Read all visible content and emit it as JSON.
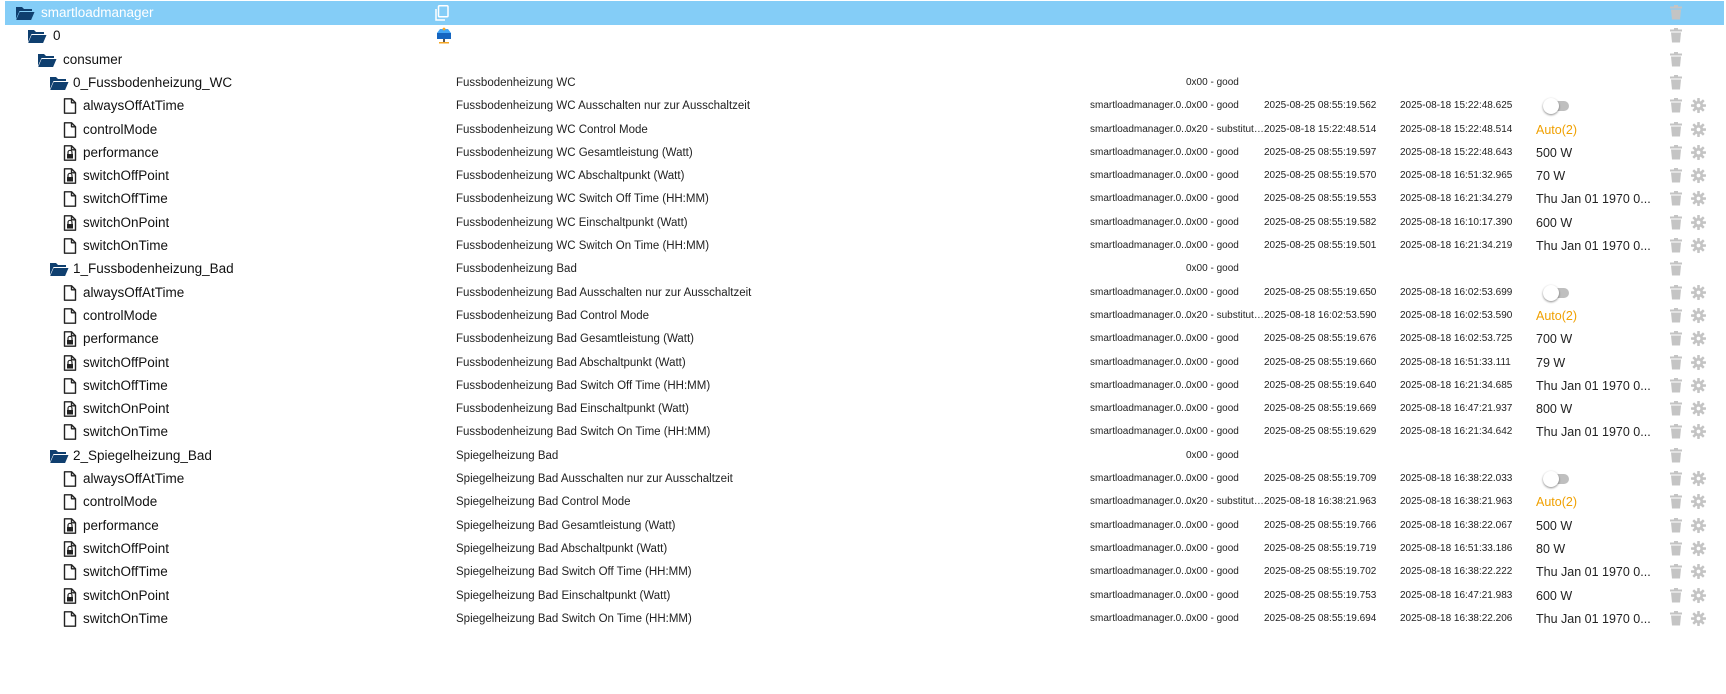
{
  "colors": {
    "selection": "#84cdf7",
    "auto_value": "#f0a000",
    "folder": "#0f3f6f",
    "action_icons": "#c4c4c4"
  },
  "root_row": {
    "name": "smartloadmanager",
    "copy_icon": "copy-icon"
  },
  "instance_row": {
    "name": "0",
    "adapter_icon": "smartloadmanager-logo-icon"
  },
  "consumer_row": {
    "name": "consumer"
  },
  "groups": [
    {
      "name": "0_Fussbodenheizung_WC",
      "desc": "Fussbodenheizung WC",
      "quality": "0x00 - good",
      "states": [
        {
          "name": "alwaysOffAtTime",
          "icon": "file",
          "desc": "Fussbodenheizung WC Ausschalten nur zur Ausschaltzeit",
          "from": "smartloadmanager.0...",
          "quality": "0x00 - good",
          "ts": "2025-08-25 08:55:19.562",
          "lc": "2025-08-18 15:22:48.625",
          "value": "",
          "type": "toggle"
        },
        {
          "name": "controlMode",
          "icon": "file",
          "desc": "Fussbodenheizung WC Control Mode",
          "from": "smartloadmanager.0...",
          "quality": "0x20 - substitute...",
          "ts": "2025-08-18 15:22:48.514",
          "lc": "2025-08-18 15:22:48.514",
          "value": "Auto(2)",
          "type": "auto"
        },
        {
          "name": "performance",
          "icon": "lock",
          "desc": "Fussbodenheizung WC Gesamtleistung (Watt)",
          "from": "smartloadmanager.0...",
          "quality": "0x00 - good",
          "ts": "2025-08-25 08:55:19.597",
          "lc": "2025-08-18 15:22:48.643",
          "value": "500 W",
          "type": "text"
        },
        {
          "name": "switchOffPoint",
          "icon": "lock",
          "desc": "Fussbodenheizung WC Abschaltpunkt (Watt)",
          "from": "smartloadmanager.0...",
          "quality": "0x00 - good",
          "ts": "2025-08-25 08:55:19.570",
          "lc": "2025-08-18 16:51:32.965",
          "value": "70 W",
          "type": "text"
        },
        {
          "name": "switchOffTime",
          "icon": "file",
          "desc": "Fussbodenheizung WC Switch Off Time (HH:MM)",
          "from": "smartloadmanager.0...",
          "quality": "0x00 - good",
          "ts": "2025-08-25 08:55:19.553",
          "lc": "2025-08-18 16:21:34.279",
          "value": "Thu Jan 01 1970 0...",
          "type": "text"
        },
        {
          "name": "switchOnPoint",
          "icon": "lock",
          "desc": "Fussbodenheizung WC Einschaltpunkt (Watt)",
          "from": "smartloadmanager.0...",
          "quality": "0x00 - good",
          "ts": "2025-08-25 08:55:19.582",
          "lc": "2025-08-18 16:10:17.390",
          "value": "600 W",
          "type": "text"
        },
        {
          "name": "switchOnTime",
          "icon": "file",
          "desc": "Fussbodenheizung WC Switch On Time (HH:MM)",
          "from": "smartloadmanager.0...",
          "quality": "0x00 - good",
          "ts": "2025-08-25 08:55:19.501",
          "lc": "2025-08-18 16:21:34.219",
          "value": "Thu Jan 01 1970 0...",
          "type": "text"
        }
      ]
    },
    {
      "name": "1_Fussbodenheizung_Bad",
      "desc": "Fussbodenheizung Bad",
      "quality": "0x00 - good",
      "states": [
        {
          "name": "alwaysOffAtTime",
          "icon": "file",
          "desc": "Fussbodenheizung Bad Ausschalten nur zur Ausschaltzeit",
          "from": "smartloadmanager.0...",
          "quality": "0x00 - good",
          "ts": "2025-08-25 08:55:19.650",
          "lc": "2025-08-18 16:02:53.699",
          "value": "",
          "type": "toggle"
        },
        {
          "name": "controlMode",
          "icon": "file",
          "desc": "Fussbodenheizung Bad Control Mode",
          "from": "smartloadmanager.0...",
          "quality": "0x20 - substitute...",
          "ts": "2025-08-18 16:02:53.590",
          "lc": "2025-08-18 16:02:53.590",
          "value": "Auto(2)",
          "type": "auto"
        },
        {
          "name": "performance",
          "icon": "lock",
          "desc": "Fussbodenheizung Bad Gesamtleistung (Watt)",
          "from": "smartloadmanager.0...",
          "quality": "0x00 - good",
          "ts": "2025-08-25 08:55:19.676",
          "lc": "2025-08-18 16:02:53.725",
          "value": "700 W",
          "type": "text"
        },
        {
          "name": "switchOffPoint",
          "icon": "lock",
          "desc": "Fussbodenheizung Bad Abschaltpunkt (Watt)",
          "from": "smartloadmanager.0...",
          "quality": "0x00 - good",
          "ts": "2025-08-25 08:55:19.660",
          "lc": "2025-08-18 16:51:33.111",
          "value": "79 W",
          "type": "text"
        },
        {
          "name": "switchOffTime",
          "icon": "file",
          "desc": "Fussbodenheizung Bad Switch Off Time (HH:MM)",
          "from": "smartloadmanager.0...",
          "quality": "0x00 - good",
          "ts": "2025-08-25 08:55:19.640",
          "lc": "2025-08-18 16:21:34.685",
          "value": "Thu Jan 01 1970 0...",
          "type": "text"
        },
        {
          "name": "switchOnPoint",
          "icon": "lock",
          "desc": "Fussbodenheizung Bad Einschaltpunkt (Watt)",
          "from": "smartloadmanager.0...",
          "quality": "0x00 - good",
          "ts": "2025-08-25 08:55:19.669",
          "lc": "2025-08-18 16:47:21.937",
          "value": "800 W",
          "type": "text"
        },
        {
          "name": "switchOnTime",
          "icon": "file",
          "desc": "Fussbodenheizung Bad Switch On Time (HH:MM)",
          "from": "smartloadmanager.0...",
          "quality": "0x00 - good",
          "ts": "2025-08-25 08:55:19.629",
          "lc": "2025-08-18 16:21:34.642",
          "value": "Thu Jan 01 1970 0...",
          "type": "text"
        }
      ]
    },
    {
      "name": "2_Spiegelheizung_Bad",
      "desc": "Spiegelheizung Bad",
      "quality": "0x00 - good",
      "states": [
        {
          "name": "alwaysOffAtTime",
          "icon": "file",
          "desc": "Spiegelheizung Bad Ausschalten nur zur Ausschaltzeit",
          "from": "smartloadmanager.0...",
          "quality": "0x00 - good",
          "ts": "2025-08-25 08:55:19.709",
          "lc": "2025-08-18 16:38:22.033",
          "value": "",
          "type": "toggle"
        },
        {
          "name": "controlMode",
          "icon": "file",
          "desc": "Spiegelheizung Bad Control Mode",
          "from": "smartloadmanager.0...",
          "quality": "0x20 - substitute...",
          "ts": "2025-08-18 16:38:21.963",
          "lc": "2025-08-18 16:38:21.963",
          "value": "Auto(2)",
          "type": "auto"
        },
        {
          "name": "performance",
          "icon": "lock",
          "desc": "Spiegelheizung Bad Gesamtleistung (Watt)",
          "from": "smartloadmanager.0...",
          "quality": "0x00 - good",
          "ts": "2025-08-25 08:55:19.766",
          "lc": "2025-08-18 16:38:22.067",
          "value": "500 W",
          "type": "text"
        },
        {
          "name": "switchOffPoint",
          "icon": "lock",
          "desc": "Spiegelheizung Bad Abschaltpunkt (Watt)",
          "from": "smartloadmanager.0...",
          "quality": "0x00 - good",
          "ts": "2025-08-25 08:55:19.719",
          "lc": "2025-08-18 16:51:33.186",
          "value": "80 W",
          "type": "text"
        },
        {
          "name": "switchOffTime",
          "icon": "file",
          "desc": "Spiegelheizung Bad Switch Off Time (HH:MM)",
          "from": "smartloadmanager.0...",
          "quality": "0x00 - good",
          "ts": "2025-08-25 08:55:19.702",
          "lc": "2025-08-18 16:38:22.222",
          "value": "Thu Jan 01 1970 0...",
          "type": "text"
        },
        {
          "name": "switchOnPoint",
          "icon": "lock",
          "desc": "Spiegelheizung Bad Einschaltpunkt (Watt)",
          "from": "smartloadmanager.0...",
          "quality": "0x00 - good",
          "ts": "2025-08-25 08:55:19.753",
          "lc": "2025-08-18 16:47:21.983",
          "value": "600 W",
          "type": "text"
        },
        {
          "name": "switchOnTime",
          "icon": "file",
          "desc": "Spiegelheizung Bad Switch On Time (HH:MM)",
          "from": "smartloadmanager.0...",
          "quality": "0x00 - good",
          "ts": "2025-08-25 08:55:19.694",
          "lc": "2025-08-18 16:38:22.206",
          "value": "Thu Jan 01 1970 0...",
          "type": "text"
        }
      ]
    }
  ]
}
